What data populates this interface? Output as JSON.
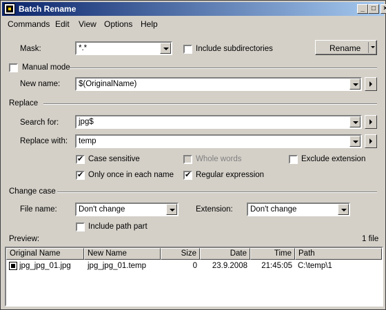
{
  "window": {
    "title": "Batch Rename"
  },
  "titlebar_buttons": {
    "minimize": "_",
    "maximize": "□",
    "close": "×"
  },
  "menubar": {
    "items": [
      "Commands",
      "Edit",
      "View",
      "Options",
      "Help"
    ]
  },
  "mask": {
    "label": "Mask:",
    "value": "*.*"
  },
  "include_subdirectories": {
    "label": "Include subdirectories",
    "checked": false
  },
  "rename_button": {
    "label": "Rename"
  },
  "manual_mode": {
    "label": "Manual mode",
    "checked": false
  },
  "new_name": {
    "label": "New name:",
    "value": "$(OriginalName)"
  },
  "replace_section": {
    "label": "Replace"
  },
  "search_for": {
    "label": "Search for:",
    "value": "jpg$"
  },
  "replace_with": {
    "label": "Replace with:",
    "value": "temp"
  },
  "options": {
    "case_sensitive": {
      "label": "Case sensitive",
      "checked": true
    },
    "whole_words": {
      "label": "Whole words",
      "checked": false,
      "disabled": true
    },
    "exclude_extension": {
      "label": "Exclude extension",
      "checked": false
    },
    "only_once": {
      "label": "Only once in each name",
      "checked": true
    },
    "regular_expression": {
      "label": "Regular expression",
      "checked": true
    }
  },
  "change_case_section": {
    "label": "Change case"
  },
  "file_name_case": {
    "label": "File name:",
    "value": "Don't change"
  },
  "extension_case": {
    "label": "Extension:",
    "value": "Don't change"
  },
  "include_path_part": {
    "label": "Include path part",
    "checked": false
  },
  "preview": {
    "label": "Preview:",
    "count": "1 file"
  },
  "columns": [
    "Original Name",
    "New Name",
    "Size",
    "Date",
    "Time",
    "Path"
  ],
  "rows": [
    {
      "original": "jpg_jpg_01.jpg",
      "new": "jpg_jpg_01.temp",
      "size": "0",
      "date": "23.9.2008",
      "time": "21:45:05",
      "path": "C:\\temp\\1"
    }
  ]
}
